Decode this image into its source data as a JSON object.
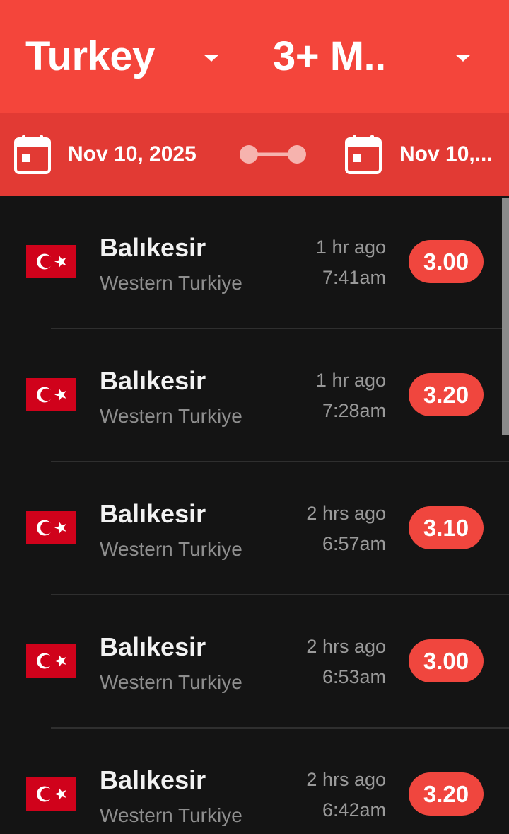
{
  "filters": {
    "country_value": "Turkey",
    "magnitude_value": "3+ M.."
  },
  "date_range": {
    "start": "Nov 10, 2025",
    "end": "Nov 10,..."
  },
  "colors": {
    "header": "#f4453b",
    "date_bar": "#e23a34",
    "badge": "#f0463e",
    "background": "#141414"
  },
  "icons": {
    "country_dropdown": "chevron-down-icon",
    "magnitude_dropdown": "chevron-down-icon",
    "start_date": "calendar-icon",
    "end_date": "calendar-icon",
    "range": "range-connector-icon",
    "flag": "turkey-flag-icon"
  },
  "earthquakes": [
    {
      "place": "Balıkesir",
      "region": "Western Turkiye",
      "ago": "1 hr ago",
      "time": "7:41am",
      "magnitude": "3.00"
    },
    {
      "place": "Balıkesir",
      "region": "Western Turkiye",
      "ago": "1 hr ago",
      "time": "7:28am",
      "magnitude": "3.20"
    },
    {
      "place": "Balıkesir",
      "region": "Western Turkiye",
      "ago": "2 hrs ago",
      "time": "6:57am",
      "magnitude": "3.10"
    },
    {
      "place": "Balıkesir",
      "region": "Western Turkiye",
      "ago": "2 hrs ago",
      "time": "6:53am",
      "magnitude": "3.00"
    },
    {
      "place": "Balıkesir",
      "region": "Western Turkiye",
      "ago": "2 hrs ago",
      "time": "6:42am",
      "magnitude": "3.20"
    }
  ]
}
